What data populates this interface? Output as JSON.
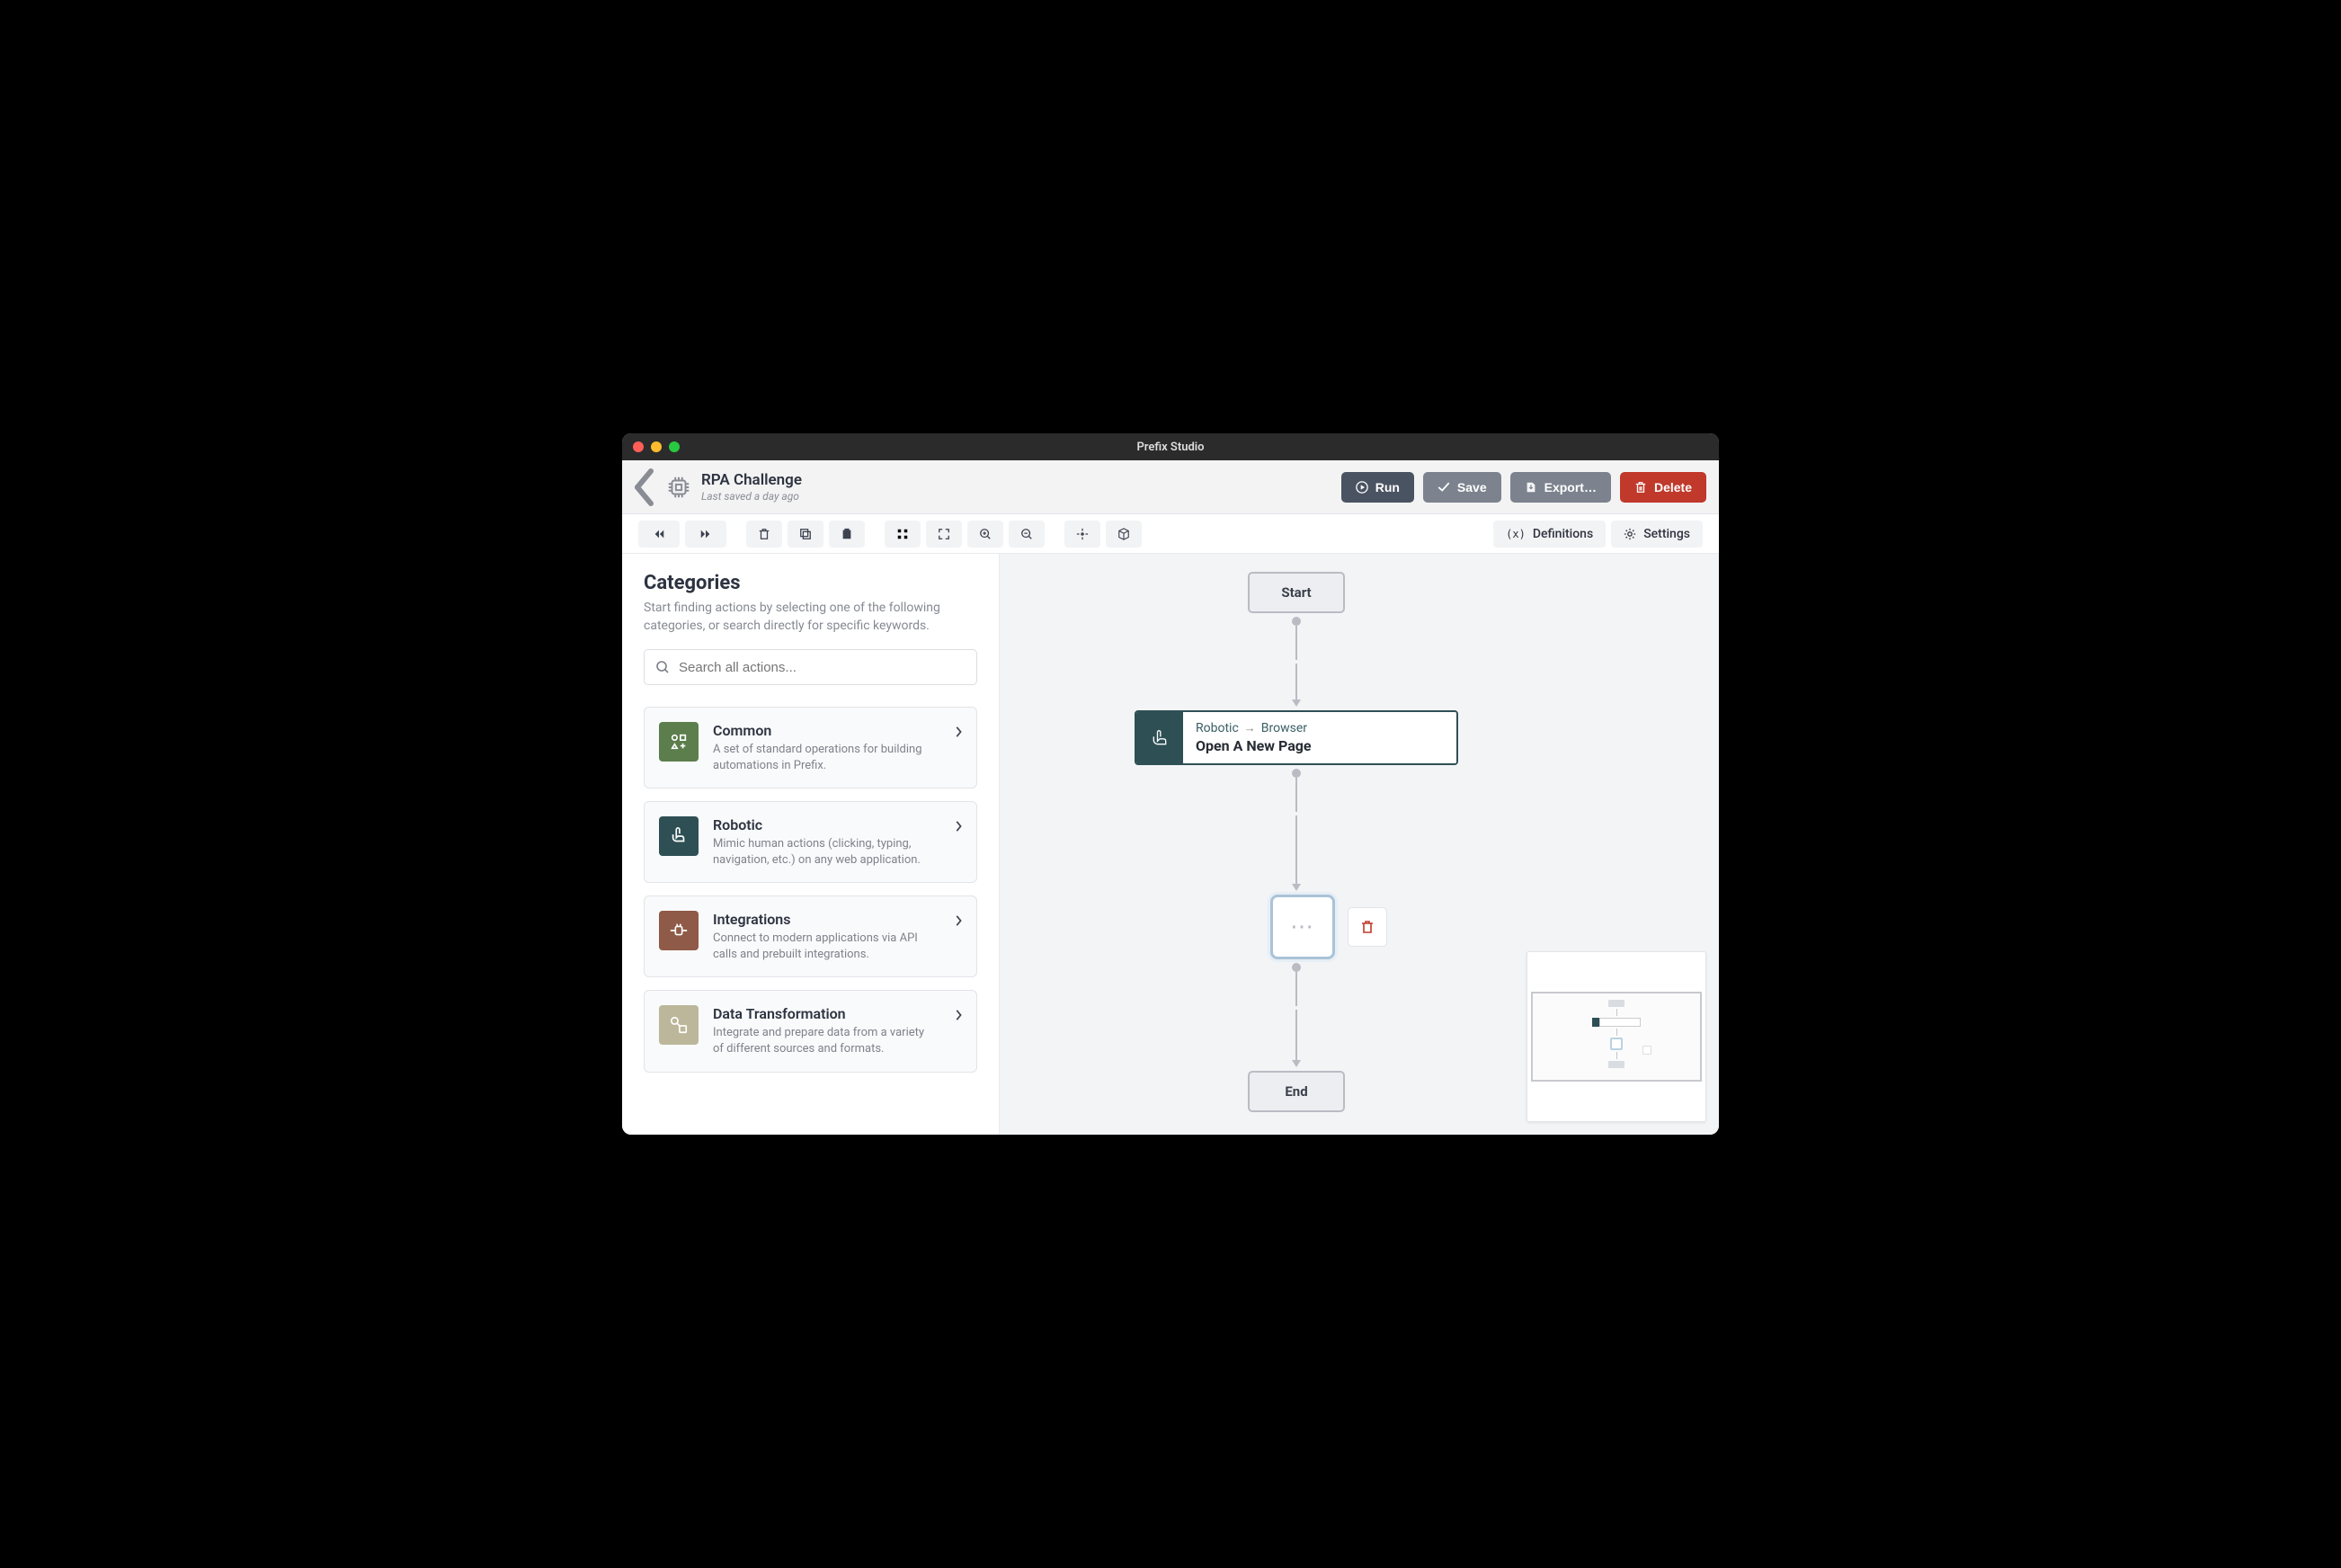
{
  "app": {
    "title": "Prefix Studio"
  },
  "header": {
    "doc_title": "RPA Challenge",
    "doc_subtitle": "Last saved a day ago",
    "actions": {
      "run": "Run",
      "save": "Save",
      "export": "Export…",
      "delete": "Delete"
    }
  },
  "toolbar": {
    "definitions": "Definitions",
    "settings": "Settings"
  },
  "sidebar": {
    "heading": "Categories",
    "description": "Start finding actions by selecting one of the following categories, or search directly for specific keywords.",
    "search_placeholder": "Search all actions...",
    "categories": [
      {
        "name": "Common",
        "desc": "A set of standard operations for building automations in Prefix.",
        "color": "#5c7d4c"
      },
      {
        "name": "Robotic",
        "desc": "Mimic human actions (clicking, typing, navigation, etc.) on any web application.",
        "color": "#2e5055"
      },
      {
        "name": "Integrations",
        "desc": "Connect to modern applications via API calls and prebuilt integrations.",
        "color": "#8f5a47"
      },
      {
        "name": "Data Transformation",
        "desc": "Integrate and prepare data from a variety of different sources and formats.",
        "color": "#bcb79a"
      }
    ]
  },
  "flow": {
    "start": "Start",
    "end": "End",
    "action": {
      "path_parent": "Robotic",
      "path_child": "Browser",
      "title": "Open A New Page"
    }
  }
}
